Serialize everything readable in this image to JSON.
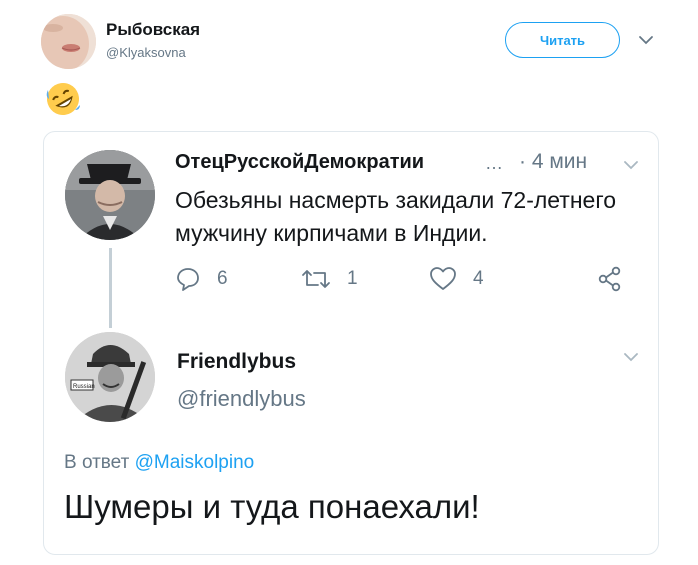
{
  "outer_tweet": {
    "author_name": "Рыбовская",
    "author_handle": "@Klyaksovna",
    "follow_label": "Читать",
    "emoji": "rolling-on-floor-laughing"
  },
  "quoted_thread": {
    "first_tweet": {
      "author_name": "ОтецРусскойДемократии",
      "ellipsis": "…",
      "time": "· 4 мин",
      "text": "Обезьяны насмерть закидали 72-летнего мужчину кирпичами в Индии.",
      "reply_count": "6",
      "retweet_count": "1",
      "like_count": "4"
    },
    "reply_tweet": {
      "author_name": "Friendlybus",
      "author_handle": "@friendlybus",
      "reply_prefix": "В ответ",
      "reply_mention": "@Maiskolpino",
      "text": "Шумеры и туда понаехали!"
    }
  },
  "colors": {
    "accent": "#1da1f2",
    "muted": "#657786",
    "border": "#e1e8ed",
    "text": "#14171a"
  }
}
